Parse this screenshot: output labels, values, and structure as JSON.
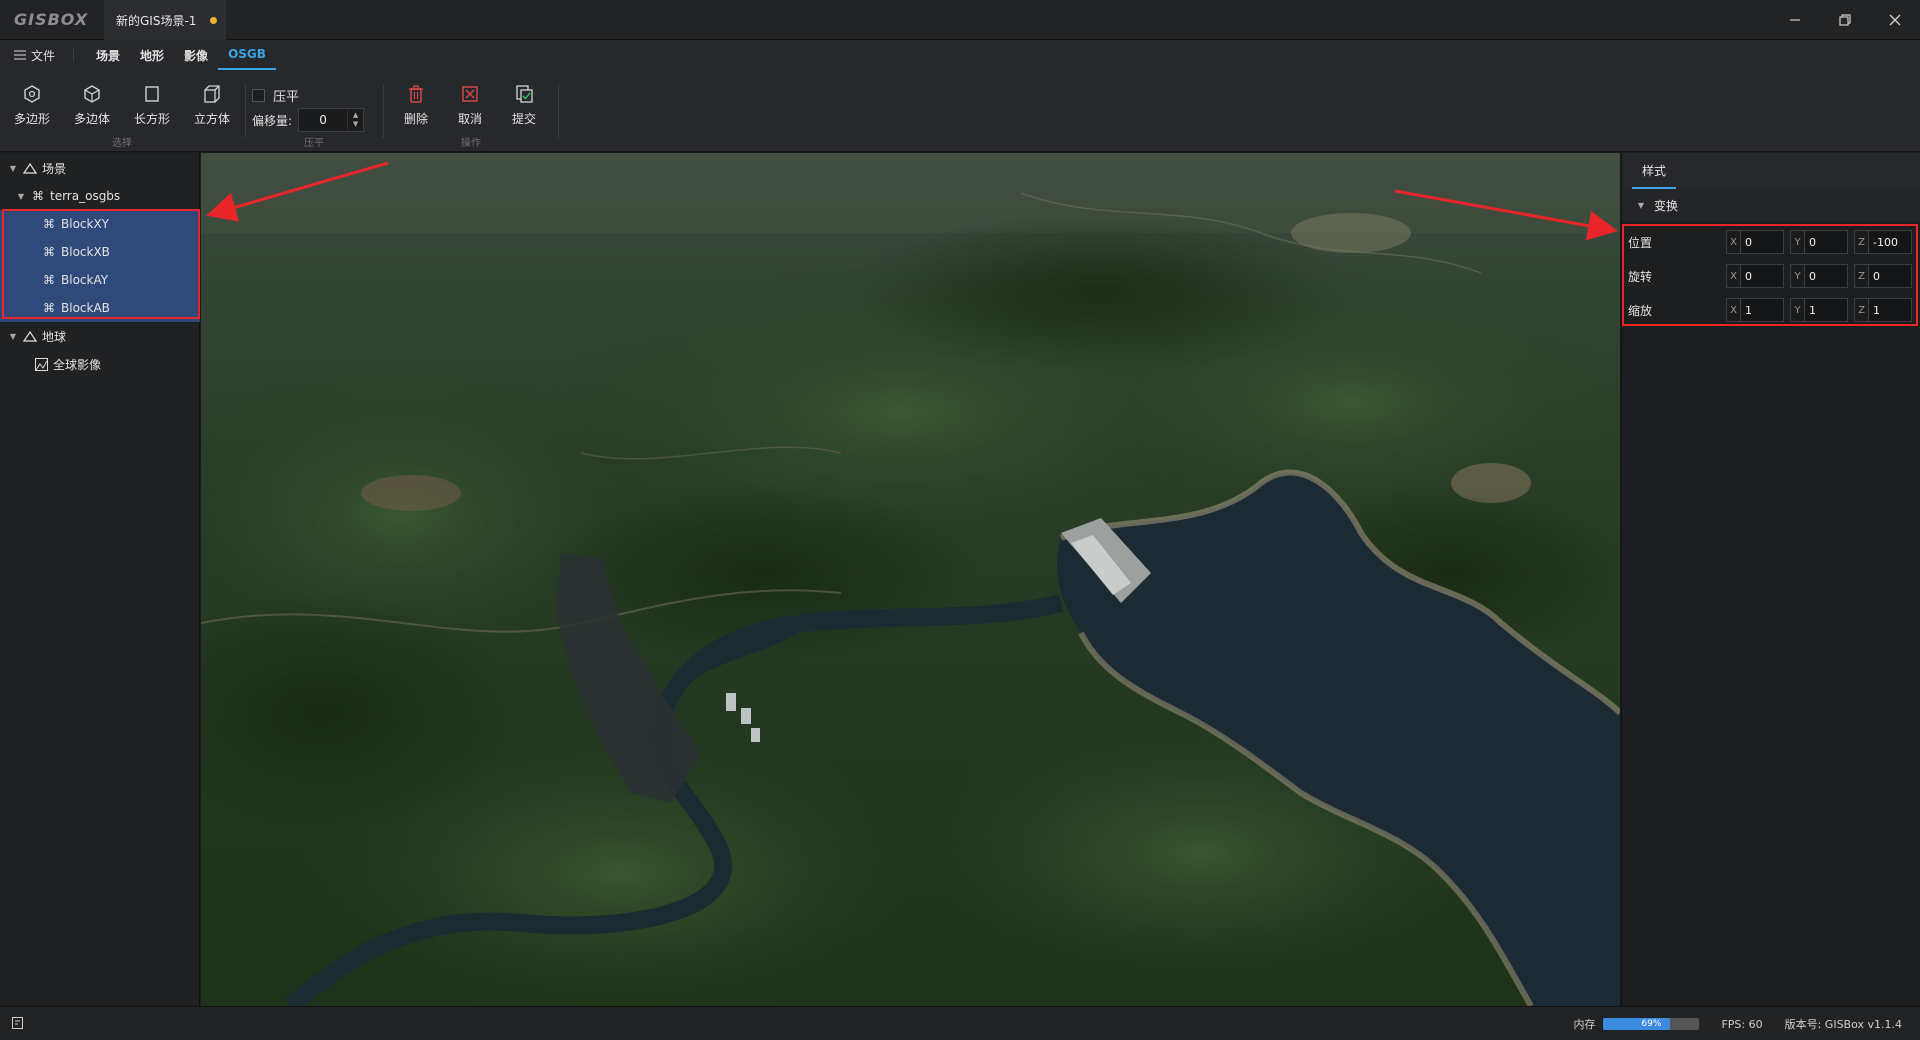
{
  "app": {
    "logo": "GISBOX",
    "doc_tab": "新的GIS场景-1",
    "unsaved_color": "#f0b030"
  },
  "menu": {
    "file": "文件",
    "items": [
      "场景",
      "地形",
      "影像",
      "OSGB"
    ],
    "active": "OSGB",
    "accent": "#3aa4e6"
  },
  "toolbar": {
    "select_group": {
      "label": "选择",
      "buttons": [
        "多边形",
        "多边体",
        "长方形",
        "立方体"
      ]
    },
    "flatten_group": {
      "label": "压平",
      "checkbox_label": "压平",
      "offset_label": "偏移量:",
      "offset_value": "0"
    },
    "ops_group": {
      "label": "操作",
      "buttons": [
        "删除",
        "取消",
        "提交"
      ]
    }
  },
  "tree": {
    "scene": "场景",
    "osgb_root": "terra_osgbs",
    "blocks": [
      "BlockXY",
      "BlockXB",
      "BlockAY",
      "BlockAB"
    ],
    "globe": "地球",
    "imagery": "全球影像"
  },
  "props": {
    "tab": "样式",
    "section": "变换",
    "rows": [
      {
        "name": "位置",
        "x": "0",
        "y": "0",
        "z": "-100"
      },
      {
        "name": "旋转",
        "x": "0",
        "y": "0",
        "z": "0"
      },
      {
        "name": "缩放",
        "x": "1",
        "y": "1",
        "z": "1"
      }
    ],
    "axis_labels": [
      "X",
      "Y",
      "Z"
    ]
  },
  "status": {
    "mem_label": "内存",
    "mem_percent": 69,
    "mem_text": "69%",
    "fps": "FPS: 60",
    "version": "版本号: GISBox v1.1.4"
  },
  "annotation_color": "#e8262a"
}
